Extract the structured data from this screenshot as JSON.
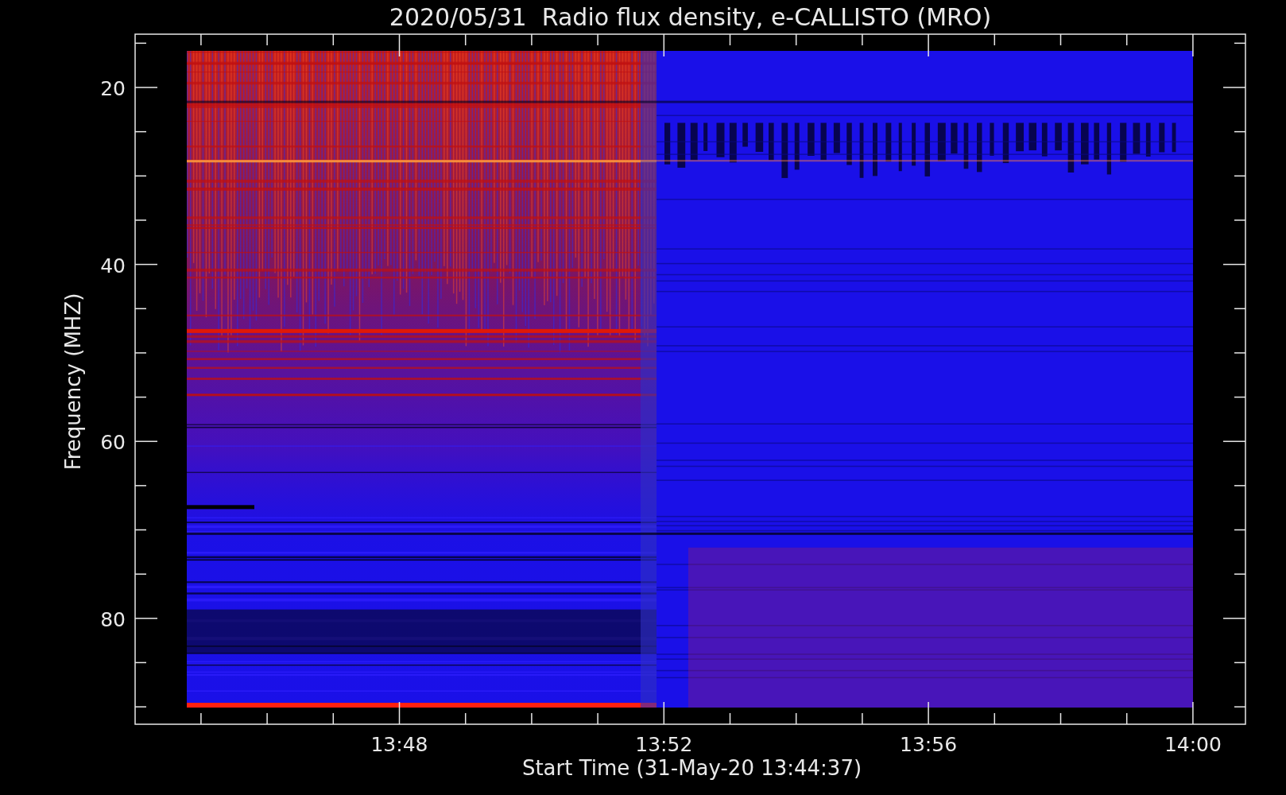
{
  "title": "2020/05/31  Radio flux density, e-CALLISTO (MRO)",
  "y_axis": {
    "label": "Frequency (MHZ)",
    "ticks": [
      "20",
      "40",
      "60",
      "80"
    ]
  },
  "x_axis": {
    "label": "Start Time (31-May-20 13:44:37)",
    "ticks": [
      "13:48",
      "13:52",
      "13:56",
      "14:00"
    ]
  }
}
